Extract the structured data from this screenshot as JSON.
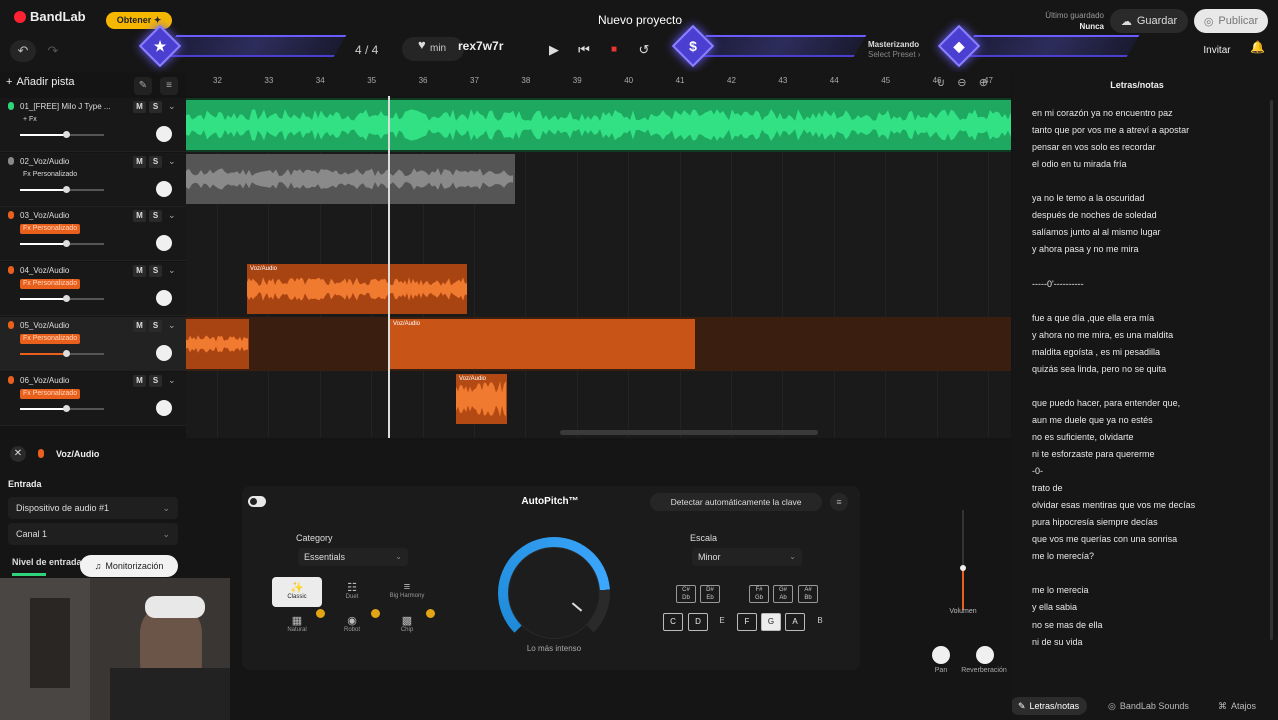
{
  "app": {
    "brand": "BandLab",
    "obtener": "Obtener ✦",
    "project_title": "Nuevo proyecto"
  },
  "topbar": {
    "saved_label": "Último guardado",
    "saved_value": "Nunca",
    "guardar": "Guardar",
    "publicar": "Publicar",
    "time_signature": "4 / 4",
    "tempo_unit": "min",
    "overlay_text": "rex7w7r",
    "mastering_title": "Masterizando",
    "mastering_sub": "Select Preset ›",
    "invitar": "Invitar",
    "add_track": "Añadir pista"
  },
  "ruler": {
    "ticks": [
      "32",
      "33",
      "34",
      "35",
      "36",
      "37",
      "38",
      "39",
      "40",
      "41",
      "42",
      "43",
      "44",
      "45",
      "46",
      "47"
    ]
  },
  "tracks": [
    {
      "name": "01_[FREE] Milo J Type ...",
      "fx": "+ Fx",
      "fx_style": "plain",
      "mic_color": "#2fd47a",
      "volume": 0.55,
      "volume_color": "#ffffff",
      "selected": false
    },
    {
      "name": "02_Voz/Audio",
      "fx": "Fx Personalizado",
      "fx_style": "plain",
      "mic_color": "#888888",
      "volume": 0.55,
      "volume_color": "#ffffff",
      "selected": false
    },
    {
      "name": "03_Voz/Audio",
      "fx": "Fx Personalizado",
      "fx_style": "org",
      "mic_color": "#e8601c",
      "volume": 0.55,
      "volume_color": "#ffffff",
      "selected": false
    },
    {
      "name": "04_Voz/Audio",
      "fx": "Fx Personalizado",
      "fx_style": "org",
      "mic_color": "#e8601c",
      "volume": 0.55,
      "volume_color": "#ffffff",
      "selected": false
    },
    {
      "name": "05_Voz/Audio",
      "fx": "Fx Personalizado",
      "fx_style": "org",
      "mic_color": "#e8601c",
      "volume": 0.55,
      "volume_color": "#e8601c",
      "selected": true
    },
    {
      "name": "06_Voz/Audio",
      "fx": "Fx Personalizado",
      "fx_style": "org",
      "mic_color": "#e8601c",
      "volume": 0.55,
      "volume_color": "#ffffff",
      "selected": false
    }
  ],
  "track_ms": {
    "m": "M",
    "s": "S"
  },
  "clips": [
    {
      "label": "Voz/Audio"
    },
    {
      "label": "Voz/Audio"
    },
    {
      "label": "Voz/Audio"
    }
  ],
  "colors": {
    "green": "#2fd47a",
    "gray": "#6d6d6d",
    "orange": "#e8601c",
    "accent": "#4b3fd1"
  },
  "lyrics": {
    "title": "Letras/notas",
    "lines": [
      "en mi corazón ya no encuentro paz",
      "tanto que por vos me a  atreví a apostar",
      "pensar en vos solo es recordar",
      "el odio en tu mirada fría",
      "",
      "ya no le temo a la oscuridad",
      "después de noches de soledad",
      "salíamos junto al  al  mismo lugar",
      "y ahora pasa y no me mira",
      "",
      "-----0'----------",
      "",
      "fue a que día ,que ella era mía",
      "y ahora no me mira, es una maldita",
      "maldita egoísta , es mi pesadilla",
      "quizás sea linda, pero no se quita",
      "",
      "que puedo hacer, para entender que,",
      "aun me duele que ya no estés",
      "no es suficiente, olvidarte",
      "ni te esforzaste para quererme",
      "-0-",
      "trato de",
      "olvidar esas mentiras que vos me decías",
      "pura hipocresía siempre decías",
      "que vos me querías con una sonrisa",
      "me lo merecía?",
      "",
      "me lo merecia",
      "y ella sabia",
      "no se mas de ella",
      "ni de su vida"
    ]
  },
  "bottom_tabs": {
    "lyrics": "Letras/notas",
    "sounds": "BandLab Sounds",
    "shortcuts": "Atajos"
  },
  "lower": {
    "selected_track": "Voz/Audio",
    "input_label": "Entrada",
    "device": "Dispositivo de audio #1",
    "channel": "Canal 1",
    "level_label": "Nivel de entrada",
    "monitor": "Monitorización"
  },
  "plugin": {
    "title": "AutoPitch™",
    "detect_button": "Detectar automáticamente la clave",
    "category_label": "Category",
    "category_value": "Essentials",
    "scale_label": "Escala",
    "scale_value": "Minor",
    "knob_label": "Lo más intenso",
    "knob_value": 0.82,
    "modes": [
      "Classic",
      "Duet",
      "Big Harmony",
      "Natural",
      "Robot",
      "Chip"
    ],
    "keys_upper": [
      "C#\nDb",
      "D#\nEb",
      "F#\nGb",
      "G#\nAb",
      "A#\nBb"
    ],
    "keys_lower": [
      "C",
      "D",
      "E",
      "F",
      "G",
      "A",
      "B"
    ]
  },
  "mixer": {
    "volume_label": "Volumen",
    "volume_level": 0.7,
    "pan_label": "Pan",
    "reverb_label": "Reverberación"
  }
}
